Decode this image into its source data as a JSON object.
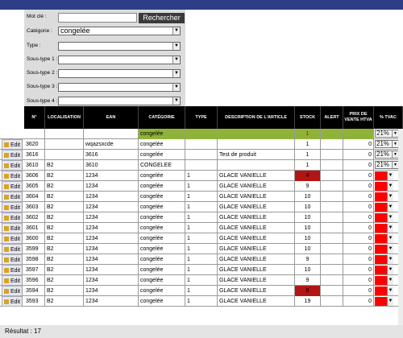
{
  "search": {
    "keyword_label": "Mot clé :",
    "keyword_value": "",
    "search_button": "Rechercher",
    "category_label": "Catégorie :",
    "category_value": "congelée",
    "type_label": "Type :",
    "subtype1_label": "Sous-type 1 :",
    "subtype2_label": "Sous-type 2 :",
    "subtype3_label": "Sous-type 3 :",
    "subtype4_label": "Sous-type 4 :"
  },
  "table": {
    "headers": {
      "num": "N°",
      "localisation": "LOCALISATION",
      "ean": "EAN",
      "categorie": "CATÉGORIE",
      "type": "TYPE",
      "description": "DESCRIPTION DE L'ARTICLE",
      "stock": "STOCK",
      "alert": "ALERT",
      "prix": "PRIX DE VENTE HTVA",
      "tva": "% TVAC"
    },
    "filter_row": {
      "categorie": "congelée",
      "stock": "1",
      "tva": "21%"
    },
    "edit_label": "Edit",
    "rows": [
      {
        "num": "3620",
        "loc": "",
        "ean": "wqazsxcde",
        "cat": "congelée",
        "type": "",
        "desc": "",
        "stock": "1",
        "alert": "",
        "prix": "0",
        "tva": "21%"
      },
      {
        "num": "3616",
        "loc": "",
        "ean": "3616",
        "cat": "congelée",
        "type": "",
        "desc": "Test de produit",
        "stock": "1",
        "alert": "",
        "prix": "0",
        "tva": "21%"
      },
      {
        "num": "3610",
        "loc": "B2",
        "ean": "3610",
        "cat": "CONGELEE",
        "type": "",
        "desc": "",
        "stock": "1",
        "alert": "",
        "prix": "0",
        "tva": "21%"
      },
      {
        "num": "3606",
        "loc": "B2",
        "ean": "1234",
        "cat": "congelée",
        "type": "1",
        "desc": "GLACE VANIELLE",
        "stock": "4",
        "alert": "",
        "prix": "0",
        "tva": ""
      },
      {
        "num": "3605",
        "loc": "B2",
        "ean": "1234",
        "cat": "congelée",
        "type": "1",
        "desc": "GLACE VANIELLE",
        "stock": "9",
        "alert": "",
        "prix": "0",
        "tva": ""
      },
      {
        "num": "3604",
        "loc": "B2",
        "ean": "1234",
        "cat": "congelée",
        "type": "1",
        "desc": "GLACE VANIELLE",
        "stock": "10",
        "alert": "",
        "prix": "0",
        "tva": ""
      },
      {
        "num": "3603",
        "loc": "B2",
        "ean": "1234",
        "cat": "congelée",
        "type": "1",
        "desc": "GLACE VANIELLE",
        "stock": "10",
        "alert": "",
        "prix": "0",
        "tva": ""
      },
      {
        "num": "3602",
        "loc": "B2",
        "ean": "1234",
        "cat": "congelée",
        "type": "1",
        "desc": "GLACE VANIELLE",
        "stock": "10",
        "alert": "",
        "prix": "0",
        "tva": ""
      },
      {
        "num": "3601",
        "loc": "B2",
        "ean": "1234",
        "cat": "congelée",
        "type": "1",
        "desc": "GLACE VANIELLE",
        "stock": "10",
        "alert": "",
        "prix": "0",
        "tva": ""
      },
      {
        "num": "3600",
        "loc": "B2",
        "ean": "1234",
        "cat": "congelée",
        "type": "1",
        "desc": "GLACE VANIELLE",
        "stock": "10",
        "alert": "",
        "prix": "0",
        "tva": ""
      },
      {
        "num": "3599",
        "loc": "B2",
        "ean": "1234",
        "cat": "congelée",
        "type": "1",
        "desc": "GLACE VANIELLE",
        "stock": "10",
        "alert": "",
        "prix": "0",
        "tva": ""
      },
      {
        "num": "3598",
        "loc": "B2",
        "ean": "1234",
        "cat": "congelée",
        "type": "1",
        "desc": "GLACE VANIELLE",
        "stock": "9",
        "alert": "",
        "prix": "0",
        "tva": ""
      },
      {
        "num": "3597",
        "loc": "B2",
        "ean": "1234",
        "cat": "congelée",
        "type": "1",
        "desc": "GLACE VANIELLE",
        "stock": "10",
        "alert": "",
        "prix": "0",
        "tva": ""
      },
      {
        "num": "3596",
        "loc": "B2",
        "ean": "1234",
        "cat": "congelée",
        "type": "1",
        "desc": "GLACE VANIELLE",
        "stock": "9",
        "alert": "",
        "prix": "0",
        "tva": ""
      },
      {
        "num": "3594",
        "loc": "B2",
        "ean": "1234",
        "cat": "congelée",
        "type": "1",
        "desc": "GLACE VANIELLE",
        "stock": "8",
        "alert": "",
        "prix": "0",
        "tva": ""
      },
      {
        "num": "3593",
        "loc": "B2",
        "ean": "1234",
        "cat": "congelée",
        "type": "1",
        "desc": "GLACE VANIELLE",
        "stock": "19",
        "alert": "",
        "prix": "0",
        "tva": ""
      }
    ]
  },
  "low_stock_rows": [
    "3606",
    "3594"
  ],
  "footer": {
    "result_label": "Résultat : 17"
  },
  "colors": {
    "header_bar": "#2d3e87",
    "filter_row": "#8fb33a",
    "low_stock": "#b31414",
    "tva_alert": "#ff0000"
  }
}
